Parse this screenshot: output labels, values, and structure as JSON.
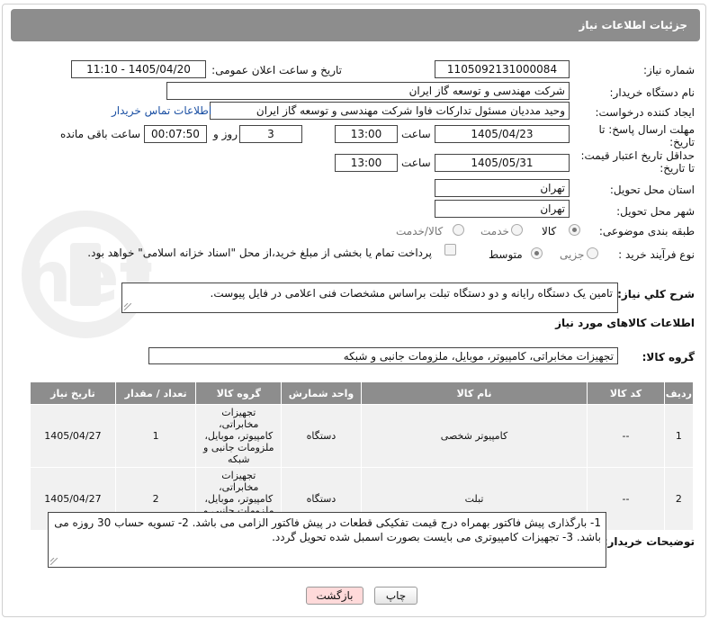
{
  "header": {
    "title": "جزئیات اطلاعات نیاز"
  },
  "form": {
    "need_number_label": "شماره نیاز:",
    "need_number": "1105092131000084",
    "announce_label": "تاریخ و ساعت اعلان عمومی:",
    "announce_value": "1405/04/20 - 11:10",
    "buyer_org_label": "نام دستگاه خریدار:",
    "buyer_org": "شرکت مهندسی و توسعه گاز ایران",
    "requester_label": "ایجاد کننده درخواست:",
    "requester": "وحید مددیان مسئول تدارکات فاوا شرکت مهندسی و توسعه گاز ایران",
    "contact_link": "اطلاعات تماس خریدار",
    "deadline_label": "مهلت ارسال پاسخ: تا تاریخ:",
    "deadline_date": "1405/04/23",
    "time_label": "ساعت",
    "deadline_time": "13:00",
    "days_value": "3",
    "days_label": "روز و",
    "remaining_value": "00:07:50",
    "remaining_label": "ساعت باقی مانده",
    "validity_label": "حداقل تاریخ اعتبار قیمت: تا تاریخ:",
    "validity_date": "1405/05/31",
    "validity_time_label": "ساعت",
    "validity_time": "13:00",
    "province_label": "استان محل تحویل:",
    "province": "تهران",
    "city_label": "شهر محل تحویل:",
    "city": "تهران",
    "category_label": "طبقه بندی موضوعی:",
    "category_options": [
      "کالا",
      "خدمت",
      "کالا/خدمت"
    ],
    "process_label": "نوع فرآیند خرید :",
    "process_options": [
      "جزیی",
      "متوسط"
    ],
    "payment_note": "پرداخت تمام یا بخشی از مبلغ خرید،از محل \"اسناد خزانه اسلامی\" خواهد بود.",
    "description_label": "شرح کلي نياز:",
    "description": "تامین یک دستگاه رایانه و دو دستگاه تبلت براساس مشخصات فنی اعلامی در فایل پیوست.",
    "goods_info_title": "اطلاعات کالاهای مورد نیاز",
    "goods_group_label": "گروه کالا:",
    "goods_group": "تجهیزات مخابراتی، کامپیوتر، موبایل، ملزومات جانبی و شبکه",
    "buyer_notes_label": "توضیحات خریدار:",
    "buyer_notes": "1- بارگذاری پیش فاکتور بهمراه درج قیمت تفکیکی قطعات  در پیش فاکتور الزامی می باشد. 2- تسویه حساب 30 روزه می باشد. 3- تجهیزات کامپیوتری می بایست بصورت اسمبل شده تحویل گردد."
  },
  "table": {
    "headers": [
      "ردیف",
      "کد کالا",
      "نام کالا",
      "واحد شمارش",
      "گروه کالا",
      "تعداد / مقدار",
      "تاریخ نیاز"
    ],
    "rows": [
      [
        "1",
        "--",
        "کامپیوتر شخصی",
        "دستگاه",
        "تجهیزات مخابراتی، کامپیوتر، موبایل، ملزومات جانبی و شبکه",
        "1",
        "1405/04/27"
      ],
      [
        "2",
        "--",
        "تبلت",
        "دستگاه",
        "تجهیزات مخابراتی، کامپیوتر، موبایل، ملزومات جانبی و شبکه",
        "2",
        "1405/04/27"
      ]
    ]
  },
  "buttons": {
    "print": "چاپ",
    "back": "بازگشت"
  },
  "colors": {
    "header_bg": "#8d8d8d",
    "cell_bg": "#f1f1f1",
    "back_button_bg": "#ffdada",
    "link": "#1a4fa3"
  },
  "watermark": {
    "text": "AriaTender.net"
  }
}
